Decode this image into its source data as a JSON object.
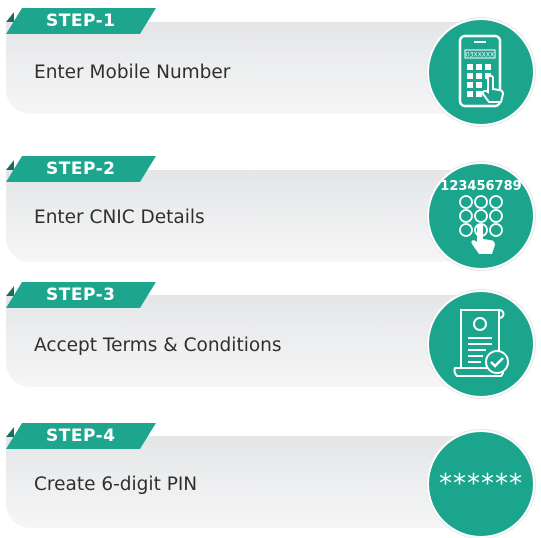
{
  "steps": [
    {
      "tab": "STEP-1",
      "label": "Enter Mobile Number",
      "icon": "mobile-keypad-icon",
      "icon_text": "03XXXXX"
    },
    {
      "tab": "STEP-2",
      "label": "Enter CNIC Details",
      "icon": "cnic-digits-keypad-icon",
      "icon_text": "123456789"
    },
    {
      "tab": "STEP-3",
      "label": "Accept Terms & Conditions",
      "icon": "terms-document-check-icon"
    },
    {
      "tab": "STEP-4",
      "label": "Create 6-digit PIN",
      "icon": "pin-icon",
      "icon_text": "******"
    }
  ],
  "colors": {
    "accent": "#1ba58d",
    "accent_dark": "#156f5f",
    "card": "#eceded",
    "text": "#2f2f2f"
  }
}
